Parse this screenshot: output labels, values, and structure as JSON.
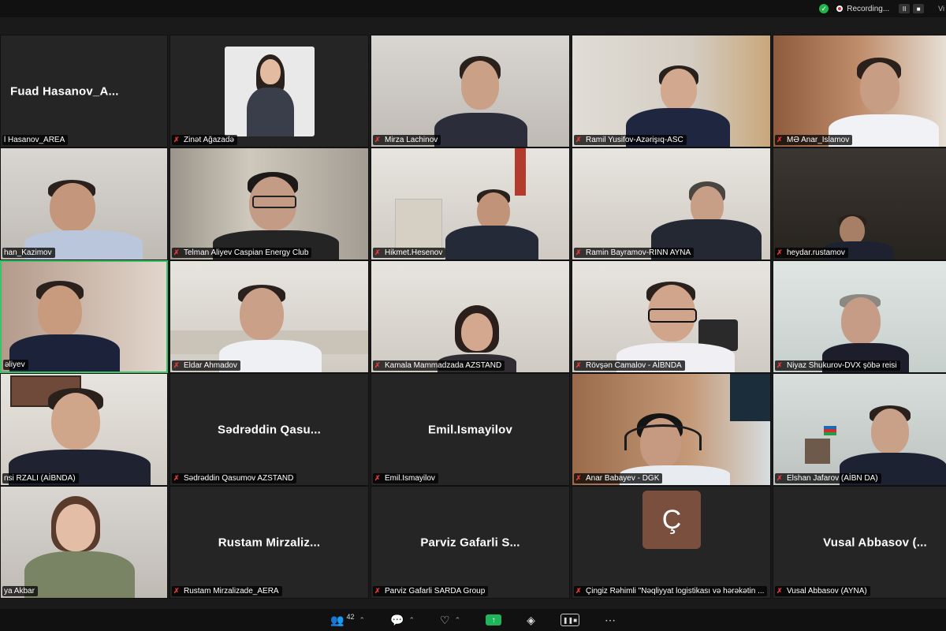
{
  "topbar": {
    "recording_label": "Recording...",
    "pause_label": "II",
    "stop_label": "■",
    "view_label": "Vi"
  },
  "tiles": [
    {
      "label": "l Hasanov_AREA",
      "center_name": "Fuad  Hasanov_A...",
      "muted": false
    },
    {
      "label": "Zinət Ağazadə",
      "muted": true
    },
    {
      "label": "Mirza Lachinov",
      "muted": true
    },
    {
      "label": "Ramil Yusifov-Azərişıq-ASC",
      "muted": true
    },
    {
      "label": "MƏ Anar_Islamov",
      "muted": true
    },
    {
      "label": "han_Kazimov",
      "muted": false
    },
    {
      "label": "Telman Aliyev Caspian Energy Club",
      "muted": true
    },
    {
      "label": "Hikmet.Hesenov",
      "muted": true
    },
    {
      "label": "Ramin Bayramov-RINN AYNA",
      "muted": true
    },
    {
      "label": "heydar.rustamov",
      "muted": true
    },
    {
      "label": "əliyev",
      "muted": false
    },
    {
      "label": "Eldar Ahmadov",
      "muted": true
    },
    {
      "label": "Kamala Mammadzada AZSTAND",
      "muted": true
    },
    {
      "label": "Rövşən Camalov - AİBNDA",
      "muted": true
    },
    {
      "label": "Niyaz Shukurov-DVX şöbə reisi",
      "muted": true
    },
    {
      "label": "nsi RZALI (AİBNDA)",
      "muted": false
    },
    {
      "label": "Sədrəddin Qasumov AZSTAND",
      "center_name": "Sədrəddin  Qasu...",
      "muted": true
    },
    {
      "label": "Emil.Ismayilov",
      "center_name": "Emil.Ismayilov",
      "muted": true
    },
    {
      "label": "Anar Babayev - DGK",
      "muted": true
    },
    {
      "label": "Elshan Jafarov (AİBN DA)",
      "muted": true
    },
    {
      "label": "ya Akbar",
      "muted": false
    },
    {
      "label": "Rustam Mirzalizade_AERA",
      "center_name": "Rustam  Mirzaliz...",
      "muted": true
    },
    {
      "label": "Parviz Gafarli  SARDA Group",
      "center_name": "Parviz  Gafarli  S...",
      "muted": true
    },
    {
      "label": "Çingiz Rəhimli \"Nəqliyyat logistikası və hərəkətin ...",
      "avatar_letter": "Ç",
      "muted": true
    },
    {
      "label": "Vusal Abbasov (AYNA)",
      "center_name": "Vusal  Abbasov  (...",
      "muted": true
    }
  ],
  "toolbar": {
    "participants_count": "42"
  }
}
